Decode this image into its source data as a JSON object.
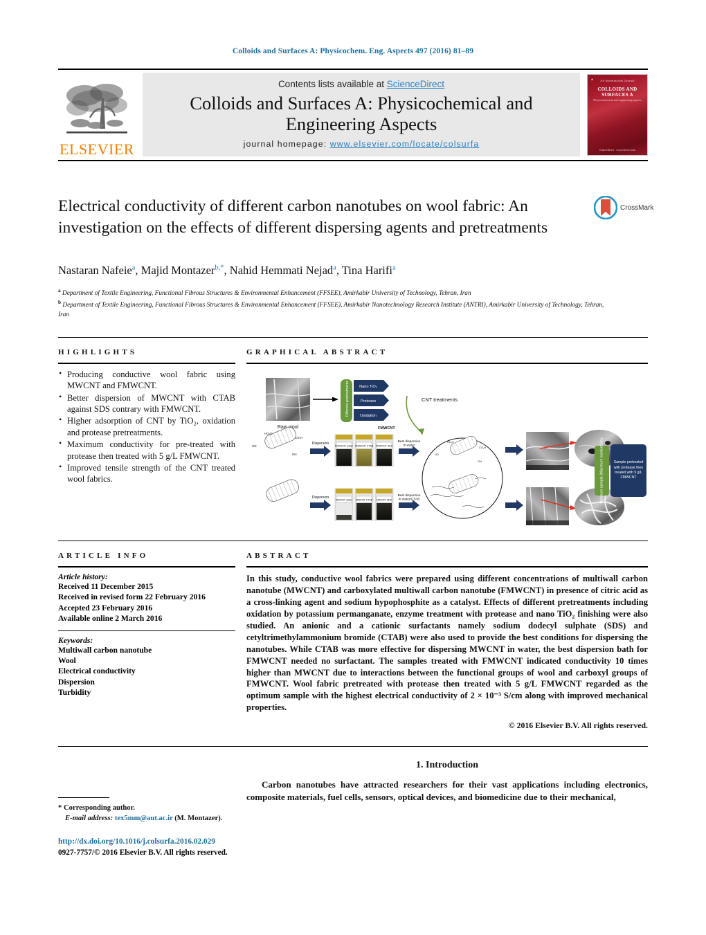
{
  "running_head": "Colloids and Surfaces A: Physicochem. Eng. Aspects 497 (2016) 81–89",
  "masthead": {
    "contents_prefix": "Contents lists available at ",
    "sciencedirect": "ScienceDirect",
    "journal_title_line1": "Colloids and Surfaces A: Physicochemical and",
    "journal_title_line2": "Engineering Aspects",
    "homepage_label": "journal homepage: ",
    "homepage_url": "www.elsevier.com/locate/colsurfa",
    "publisher": "ELSEVIER",
    "cover": {
      "top_line": "An International Journal",
      "title": "COLLOIDS AND SURFACES A",
      "subtitle": "Physicochemical and engineering aspects",
      "bottom_line": "ScienceDirect  ·  www.elsevier.com"
    }
  },
  "article": {
    "title": "Electrical conductivity of different carbon nanotubes on wool fabric: An investigation on the effects of different dispersing agents and pretreatments",
    "crossmark_label": "CrossMark",
    "authors_html": "Nastaran Nafeie<sup>a</sup>, Majid Montazer<sup>b,*</sup>, Nahid Hemmati Nejad<sup>a</sup>, Tina Harifi<sup>a</sup>",
    "affiliation_a": "Department of Textile Engineering, Functional Fibrous Structures & Environmental Enhancement (FFSEE), Amirkabir University of Technology, Tehran, Iran",
    "affiliation_b": "Department of Textile Engineering, Functional Fibrous Structures & Environmental Enhancement (FFSEE), Amirkabir Nanotechnology Research Institute (ANTRI), Amirkabir University of Technology, Tehran, Iran"
  },
  "highlights": {
    "heading": "HIGHLIGHTS",
    "items": [
      "Producing conductive wool fabric using MWCNT and FMWCNT.",
      "Better dispersion of MWCNT with CTAB against SDS contrary with FMWCNT.",
      "Higher adsorption of CNT by TiO₂, oxidation and protease pretreatments.",
      "Maximum conductivity for pre-treated with protease then treated with 5 g/L FMWCNT.",
      "Improved tensile strength of the CNT treated wool fabrics."
    ]
  },
  "graphical_abstract": {
    "heading": "GRAPHICAL ABSTRACT",
    "labels": {
      "raw_wool": "Raw wool",
      "pretreatment_bar": "Different pretreatments",
      "pretreat_1": "Nano TiO₂",
      "pretreat_2": "Protease",
      "pretreat_3": "Oxidation",
      "cnt_treatments": "CNT treatments",
      "fmwcnt_label": "FMWCNT",
      "mwcnt_label": "MWCNT",
      "dispersion_1": "Dispersion",
      "dispersion_2": "Dispersion",
      "vial_1": "FMWCNT water",
      "vial_2": "FMWCNT CTAB",
      "vial_3": "FMWCNT SDS",
      "vial_4": "MWCNT water",
      "vial_5": "MWCNT CTAB",
      "vial_6": "MWCNT SDS",
      "best_disp_1": "Best dispersion in water",
      "best_disp_2": "Best dispersion in water/CTAB",
      "optimum_bar": "Optimum sample (Maximum conductivity)",
      "optimum_box": "Sample pretreated with protease then treated with 5 g/L FMWCNT"
    }
  },
  "article_info": {
    "heading": "ARTICLE INFO",
    "history_label": "Article history:",
    "history": [
      "Received 11 December 2015",
      "Received in revised form 22 February 2016",
      "Accepted 23 February 2016",
      "Available online 2 March 2016"
    ],
    "keywords_label": "Keywords:",
    "keywords": [
      "Multiwall carbon nanotube",
      "Wool",
      "Electrical conductivity",
      "Dispersion",
      "Turbidity"
    ]
  },
  "abstract": {
    "heading": "ABSTRACT",
    "body": "In this study, conductive wool fabrics were prepared using different concentrations of multiwall carbon nanotube (MWCNT) and carboxylated multiwall carbon nanotube (FMWCNT) in presence of citric acid as a cross-linking agent and sodium hypophosphite as a catalyst. Effects of different pretreatments including oxidation by potassium permanganate, enzyme treatment with protease and nano TiO₂ finishing were also studied. An anionic and a cationic surfactants namely sodium dodecyl sulphate (SDS) and cetyltrimethylammonium bromide (CTAB) were also used to provide the best conditions for dispersing the nanotubes. While CTAB was more effective for dispersing MWCNT in water, the best dispersion bath for FMWCNT needed no surfactant. The samples treated with FMWCNT indicated conductivity 10 times higher than MWCNT due to interactions between the functional groups of wool and carboxyl groups of FMWCNT. Wool fabric pretreated with protease then treated with 5 g/L FMWCNT regarded as the optimum sample with the highest electrical conductivity of 2 × 10⁻³ S/cm along with improved mechanical properties.",
    "copyright": "© 2016 Elsevier B.V. All rights reserved."
  },
  "introduction": {
    "heading": "1.  Introduction",
    "paragraph": "Carbon nanotubes have attracted researchers for their vast applications including electronics, composite materials, fuel cells, sensors, optical devices, and biomedicine due to their mechanical,"
  },
  "footer": {
    "corresponding_marker": "*",
    "corresponding_label": "Corresponding author.",
    "email_label": "E-mail address:",
    "email": "tex5mm@aut.ac.ir",
    "email_owner": "(M. Montazer).",
    "doi_url": "http://dx.doi.org/10.1016/j.colsurfa.2016.02.029",
    "issn_line": "0927-7757/© 2016 Elsevier B.V. All rights reserved."
  },
  "colors": {
    "link": "#1f6f9b",
    "elsevier_orange": "#F08000",
    "cover_red": "#a5182a",
    "diagram_blue": "#1F3864",
    "diagram_green": "#6A9A3B"
  }
}
